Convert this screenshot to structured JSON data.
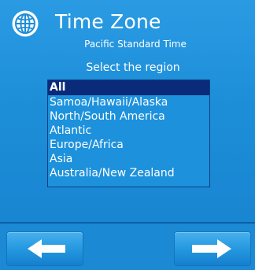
{
  "header": {
    "title": "Time Zone",
    "current_zone": "Pacific Standard Time"
  },
  "region_selector": {
    "prompt": "Select the region",
    "items": [
      {
        "label": "All",
        "selected": true
      },
      {
        "label": "Samoa/Hawaii/Alaska",
        "selected": false
      },
      {
        "label": "North/South America",
        "selected": false
      },
      {
        "label": "Atlantic",
        "selected": false
      },
      {
        "label": "Europe/Africa",
        "selected": false
      },
      {
        "label": "Asia",
        "selected": false
      },
      {
        "label": "Australia/New Zealand",
        "selected": false
      }
    ]
  },
  "footer": {
    "back_icon": "left-arrow-icon",
    "next_icon": "right-arrow-icon"
  },
  "colors": {
    "background": "#1f8fd6",
    "selected_row": "#0a2a7a",
    "text": "#ffffff"
  }
}
